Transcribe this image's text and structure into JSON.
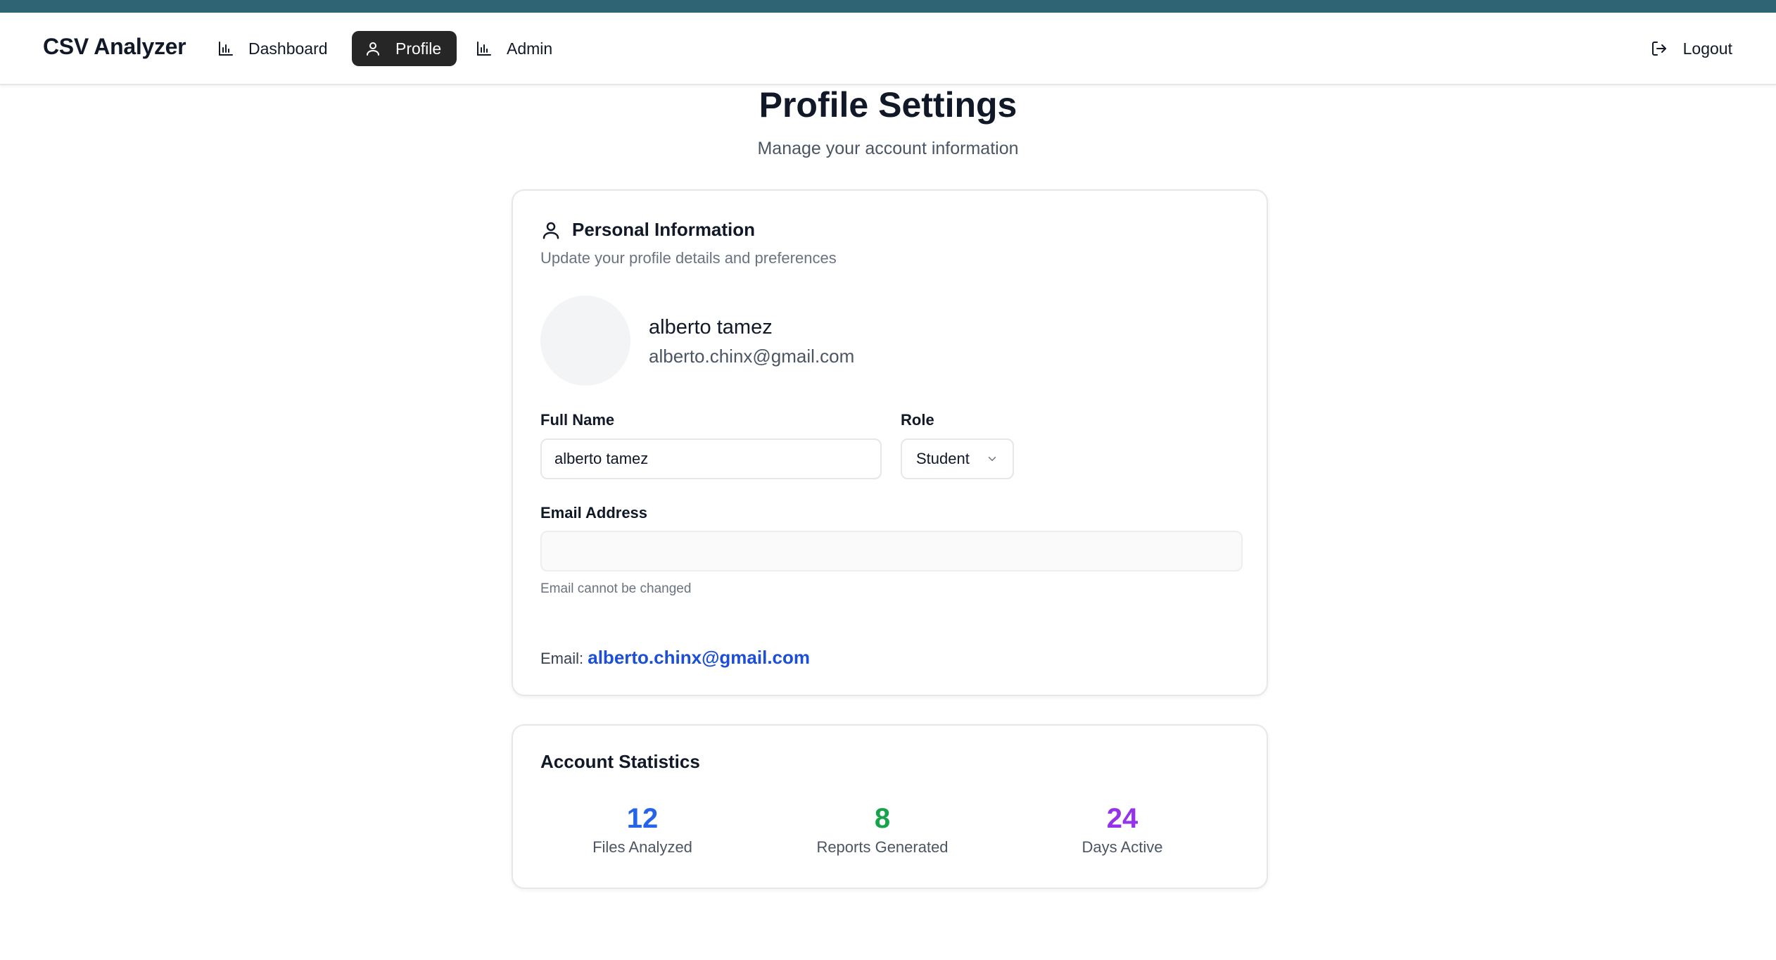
{
  "nav": {
    "brand": "CSV Analyzer",
    "items": [
      {
        "label": "Dashboard",
        "icon": "bar-chart-icon",
        "active": false
      },
      {
        "label": "Profile",
        "icon": "user-icon",
        "active": true
      },
      {
        "label": "Admin",
        "icon": "bar-chart-icon",
        "active": false
      }
    ],
    "logout_label": "Logout",
    "logout_icon": "logout-icon"
  },
  "page": {
    "title": "Profile Settings",
    "subtitle": "Manage your account information"
  },
  "personal": {
    "title": "Personal Information",
    "title_icon": "user-icon",
    "description": "Update your profile details and preferences",
    "user_name": "alberto tamez",
    "user_email": "alberto.chinx@gmail.com",
    "full_name_label": "Full Name",
    "full_name_value": "alberto tamez",
    "role_label": "Role",
    "role_value": "Student",
    "email_label": "Email Address",
    "email_value": "",
    "email_helper": "Email cannot be changed",
    "email_line_prefix": "Email:",
    "email_line_value": "alberto.chinx@gmail.com"
  },
  "stats": {
    "title": "Account Statistics",
    "items": [
      {
        "value": "12",
        "label": "Files Analyzed",
        "color": "#2563eb"
      },
      {
        "value": "8",
        "label": "Reports Generated",
        "color": "#16a34a"
      },
      {
        "value": "24",
        "label": "Days Active",
        "color": "#9333ea"
      }
    ]
  },
  "colors": {
    "top_strip": "#2f6475",
    "active_nav_bg": "#262626",
    "link": "#1d4ed8"
  }
}
